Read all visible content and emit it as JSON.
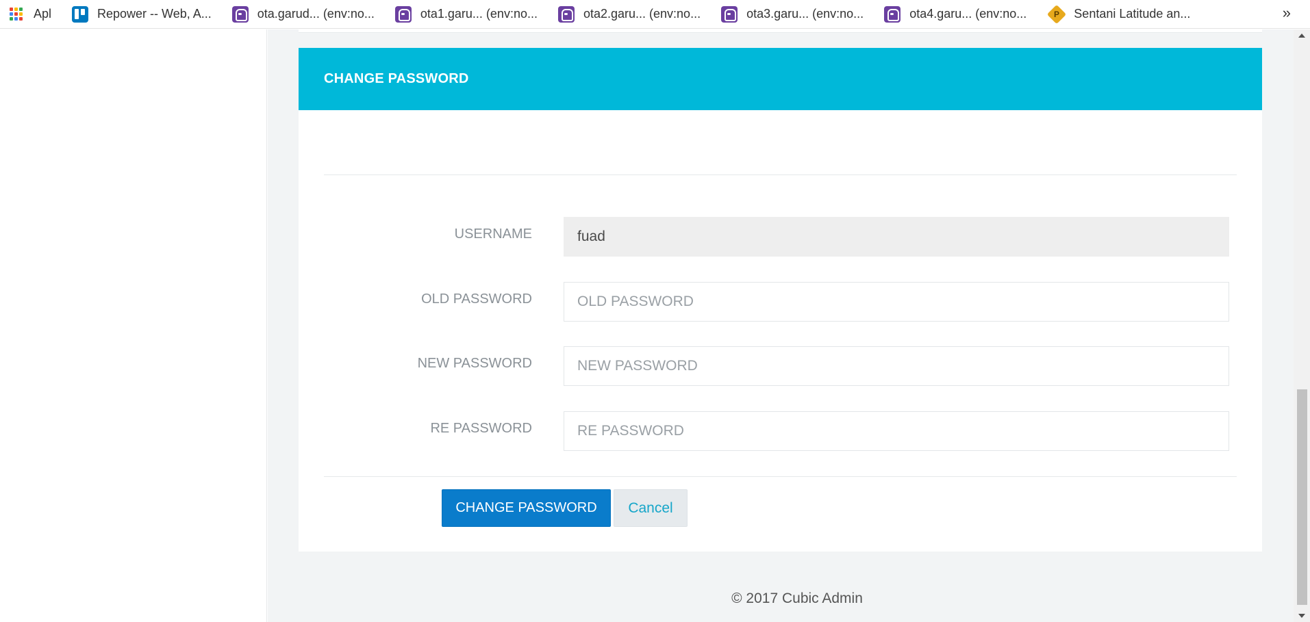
{
  "bookmarks": [
    {
      "label": "Apl",
      "icon": "apps-grid-icon"
    },
    {
      "label": "Repower -- Web, A...",
      "icon": "trello-icon"
    },
    {
      "label": "ota.garud... (env:no...",
      "icon": "datadog-icon"
    },
    {
      "label": "ota1.garu... (env:no...",
      "icon": "datadog-icon"
    },
    {
      "label": "ota2.garu... (env:no...",
      "icon": "datadog-icon"
    },
    {
      "label": "ota3.garu... (env:no...",
      "icon": "datadog-icon"
    },
    {
      "label": "ota4.garu... (env:no...",
      "icon": "datadog-icon"
    },
    {
      "label": "Sentani Latitude an...",
      "icon": "diamond-p-icon"
    }
  ],
  "bookmarks_more": "»",
  "panel": {
    "title": "CHANGE PASSWORD",
    "fields": {
      "username": {
        "label": "USERNAME",
        "value": "fuad"
      },
      "old_password": {
        "label": "OLD PASSWORD",
        "placeholder": "OLD PASSWORD"
      },
      "new_password": {
        "label": "NEW PASSWORD",
        "placeholder": "NEW PASSWORD"
      },
      "re_password": {
        "label": "RE PASSWORD",
        "placeholder": "RE PASSWORD"
      }
    },
    "submit_label": "CHANGE PASSWORD",
    "cancel_label": "Cancel"
  },
  "footer": "© 2017 Cubic Admin",
  "colors": {
    "header": "#00b8d9",
    "primary": "#0a7ccb",
    "cancel_text": "#16a6c9",
    "content_bg": "#f2f4f5"
  }
}
